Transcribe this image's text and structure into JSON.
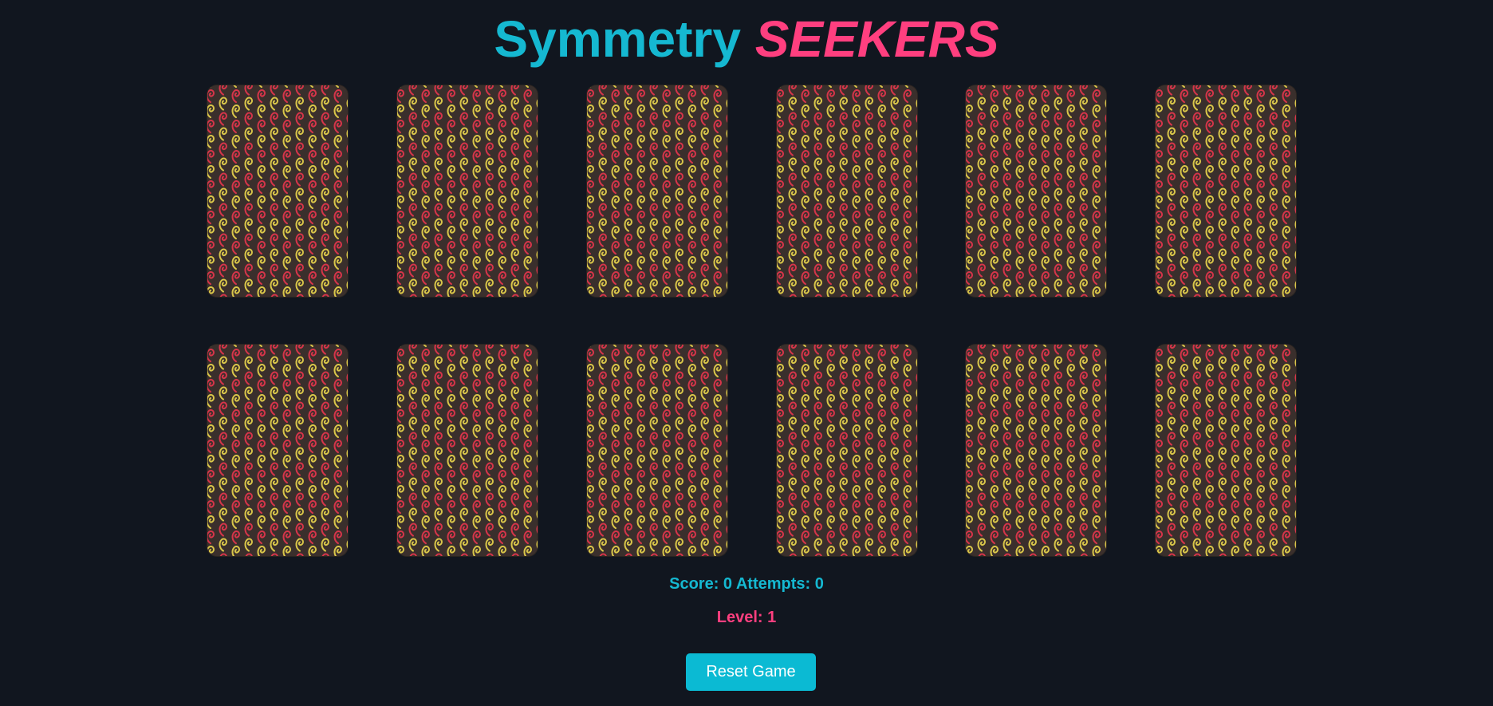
{
  "title": {
    "part1": "Symmetry",
    "part2": "SEEKERS"
  },
  "cards": [
    {
      "state": "face-down"
    },
    {
      "state": "face-down"
    },
    {
      "state": "face-down"
    },
    {
      "state": "face-down"
    },
    {
      "state": "face-down"
    },
    {
      "state": "face-down"
    },
    {
      "state": "face-down"
    },
    {
      "state": "face-down"
    },
    {
      "state": "face-down"
    },
    {
      "state": "face-down"
    },
    {
      "state": "face-down"
    },
    {
      "state": "face-down"
    }
  ],
  "stats": {
    "score_text": "Score: 0 Attempts: 0",
    "level_text": "Level: 1"
  },
  "reset_label": "Reset Game",
  "colors": {
    "background": "#11161f",
    "accent_cyan": "#15b8d1",
    "accent_pink": "#ff3f7f",
    "card_back": "#3a2f2c",
    "spiral_red": "#d6354a",
    "spiral_yellow": "#d9c64a"
  }
}
